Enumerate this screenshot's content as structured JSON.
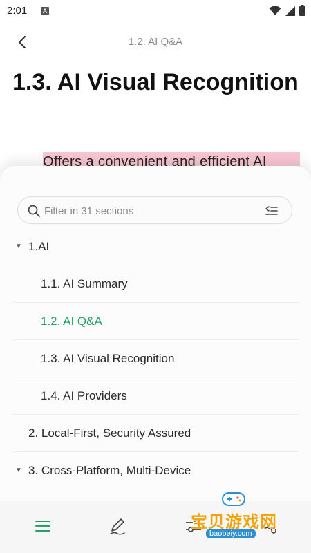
{
  "status_bar": {
    "time": "2:01",
    "notification_badge": "A",
    "icons": [
      "wifi-icon",
      "cellular-signal-icon",
      "battery-icon"
    ]
  },
  "header": {
    "back_icon": "chevron-left-icon",
    "title": "1.2. AI Q&A"
  },
  "document": {
    "heading": "1.3. AI Visual Recognition",
    "body_text": "Offers a convenient and efficient AI",
    "highlight_color": "#f8c6d3"
  },
  "outline_sheet": {
    "filter": {
      "placeholder": "Filter in 31 sections",
      "value": ""
    },
    "items": [
      {
        "label": "1.AI",
        "level": 1,
        "expanded": true
      },
      {
        "label": "1.1. AI Summary",
        "level": 2
      },
      {
        "label": "1.2. AI Q&A",
        "level": 2,
        "active": true
      },
      {
        "label": "1.3. AI Visual Recognition",
        "level": 2
      },
      {
        "label": "1.4. AI Providers",
        "level": 2
      },
      {
        "label": "2. Local-First, Security Assured",
        "level": 1
      },
      {
        "label": "3. Cross-Platform, Multi-Device",
        "level": 1,
        "expanded": true
      }
    ],
    "active_color": "#22a363"
  },
  "bottom_bar": {
    "buttons": [
      "outline-list-icon",
      "edit-pen-icon",
      "settings-sliders-icon",
      "share-icon"
    ]
  },
  "watermark": {
    "text": "宝贝游戏网",
    "url": "baobeiy.com"
  }
}
